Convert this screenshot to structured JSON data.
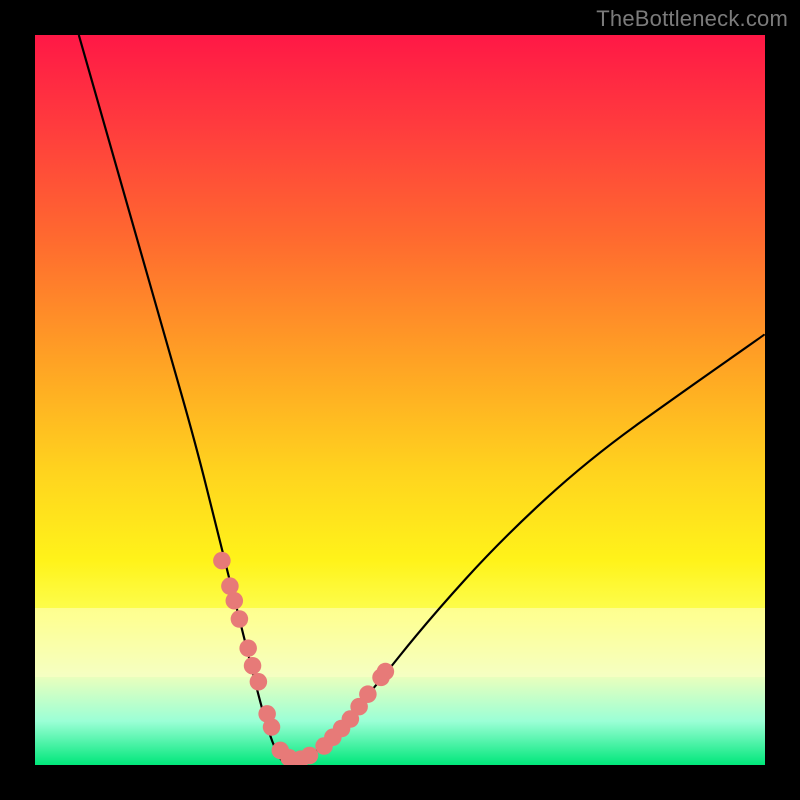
{
  "watermark": "TheBottleneck.com",
  "chart_data": {
    "type": "line",
    "title": "",
    "xlabel": "",
    "ylabel": "",
    "ylim": [
      0,
      100
    ],
    "xlim": [
      0,
      100
    ],
    "series": [
      {
        "name": "bottleneck-curve",
        "x": [
          6,
          10,
          14,
          18,
          22,
          25,
          27,
          29,
          31,
          32.5,
          34,
          36,
          40,
          46,
          54,
          64,
          76,
          90,
          100
        ],
        "y": [
          100,
          86,
          72,
          58,
          44,
          32,
          24,
          16,
          8,
          3,
          0,
          0,
          3,
          10,
          20,
          31,
          42,
          52,
          59
        ]
      }
    ],
    "marker_clusters": [
      {
        "name": "dots-left",
        "points": [
          {
            "x": 25.6,
            "y": 28.0
          },
          {
            "x": 26.7,
            "y": 24.5
          },
          {
            "x": 27.3,
            "y": 22.5
          },
          {
            "x": 28.0,
            "y": 20.0
          },
          {
            "x": 29.2,
            "y": 16.0
          },
          {
            "x": 29.8,
            "y": 13.6
          },
          {
            "x": 30.6,
            "y": 11.4
          },
          {
            "x": 31.8,
            "y": 7.0
          },
          {
            "x": 32.4,
            "y": 5.2
          },
          {
            "x": 33.6,
            "y": 2.0
          },
          {
            "x": 34.8,
            "y": 1.0
          }
        ]
      },
      {
        "name": "dots-right",
        "points": [
          {
            "x": 36.4,
            "y": 0.8
          },
          {
            "x": 37.6,
            "y": 1.3
          },
          {
            "x": 39.6,
            "y": 2.6
          },
          {
            "x": 40.8,
            "y": 3.8
          },
          {
            "x": 42.0,
            "y": 5.0
          },
          {
            "x": 43.2,
            "y": 6.3
          },
          {
            "x": 44.4,
            "y": 8.0
          },
          {
            "x": 45.6,
            "y": 9.7
          },
          {
            "x": 47.4,
            "y": 12.0
          },
          {
            "x": 48.0,
            "y": 12.8
          }
        ]
      }
    ],
    "marker_color": "#e77a78",
    "marker_radius_rel": 1.2
  }
}
